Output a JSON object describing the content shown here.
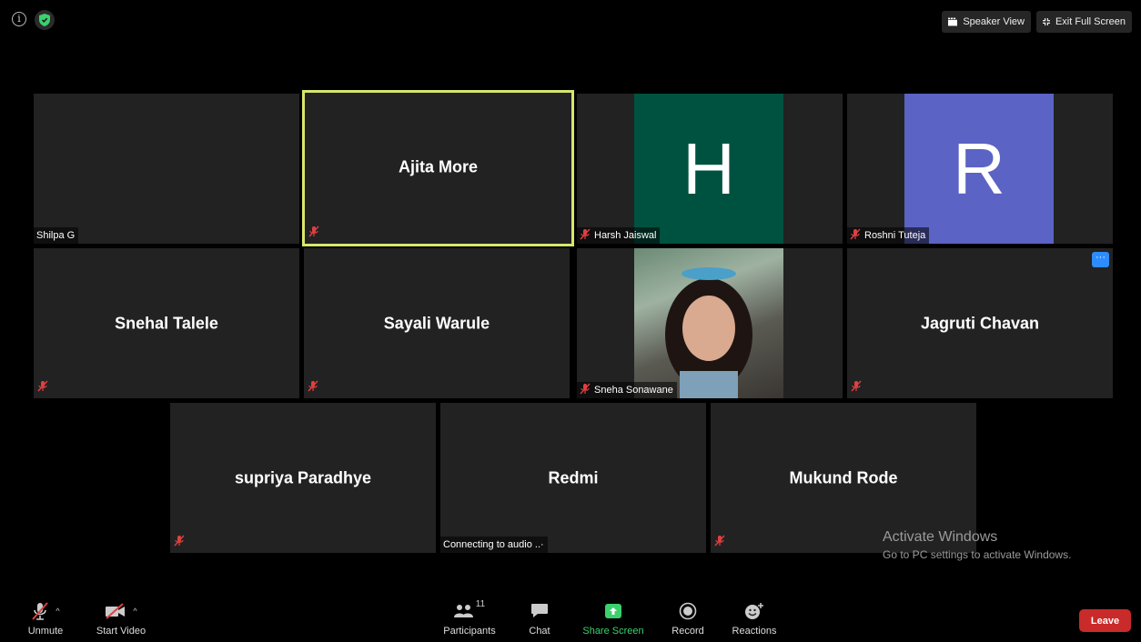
{
  "top": {
    "speaker_view": "Speaker View",
    "exit_fullscreen": "Exit Full Screen"
  },
  "participants": {
    "shilpa": "Shilpa G",
    "ajita": "Ajita More",
    "harsh": "Harsh Jaiswal",
    "harsh_initial": "H",
    "roshni": "Roshni Tuteja",
    "roshni_initial": "R",
    "snehal": "Snehal Talele",
    "sayali": "Sayali Warule",
    "sneha": "Sneha Sonawane",
    "jagruti": "Jagruti Chavan",
    "supriya": "supriya Paradhye",
    "redmi": "Redmi",
    "redmi_status": "Connecting to audio ..·",
    "mukund": "Mukund Rode",
    "more_label": "···"
  },
  "watermark": {
    "title": "Activate Windows",
    "subtitle": "Go to PC settings to activate Windows."
  },
  "controls": {
    "unmute": "Unmute",
    "start_video": "Start Video",
    "participants": "Participants",
    "participant_count": "11",
    "chat": "Chat",
    "share_screen": "Share Screen",
    "record": "Record",
    "reactions": "Reactions",
    "leave": "Leave"
  },
  "colors": {
    "active_border": "#d9e66b",
    "harsh_avatar": "#005240",
    "roshni_avatar": "#5b63c4",
    "share_green": "#3ad16c",
    "leave_red": "#c92a2a",
    "muted_red": "#e04040"
  }
}
